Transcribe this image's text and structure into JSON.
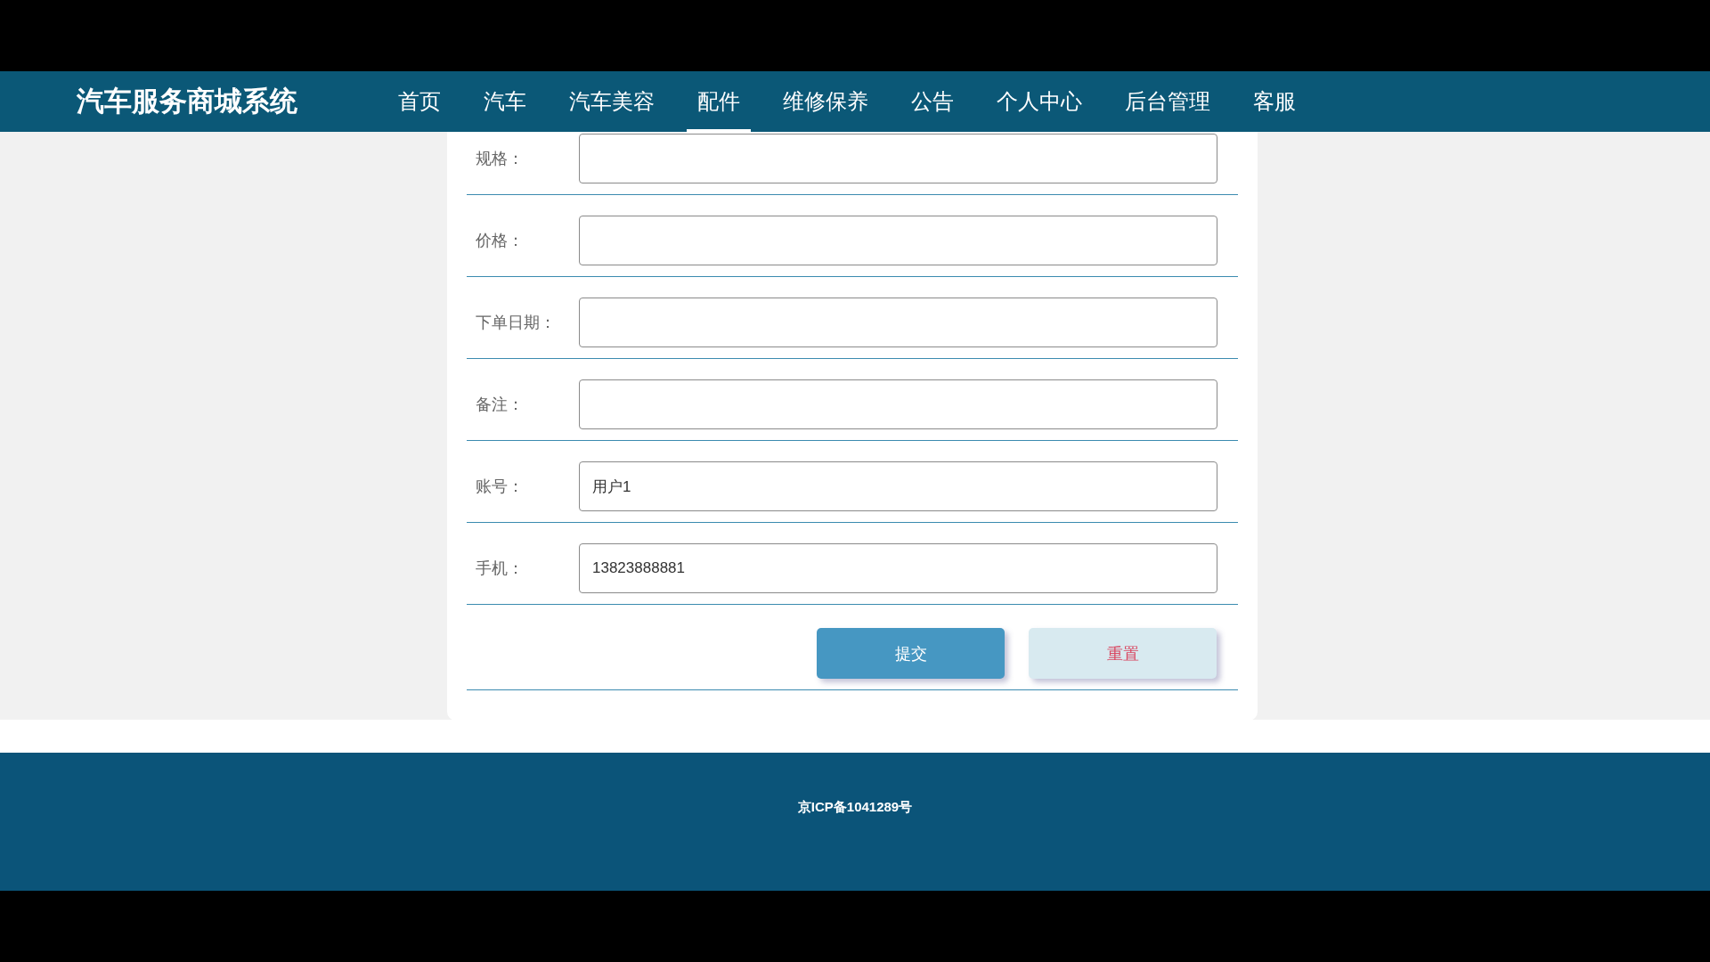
{
  "header": {
    "title": "汽车服务商城系统",
    "nav": [
      {
        "label": "首页",
        "selected": false
      },
      {
        "label": "汽车",
        "selected": false
      },
      {
        "label": "汽车美容",
        "selected": false
      },
      {
        "label": "配件",
        "selected": true
      },
      {
        "label": "维修保养",
        "selected": false
      },
      {
        "label": "公告",
        "selected": false
      },
      {
        "label": "个人中心",
        "selected": false
      },
      {
        "label": "后台管理",
        "selected": false
      },
      {
        "label": "客服",
        "selected": false
      }
    ]
  },
  "form": {
    "fields": [
      {
        "label": "规格："
      },
      {
        "label": "价格："
      },
      {
        "label": "下单日期："
      },
      {
        "label": "备注："
      },
      {
        "label": "账号：",
        "value": "用户1"
      },
      {
        "label": "手机：",
        "value": "13823888881"
      }
    ],
    "buttons": [
      {
        "kind": "submit",
        "label": "提交"
      },
      {
        "kind": "reset",
        "label": "重置"
      }
    ]
  },
  "footer": {
    "text": "京ICP备1041289号"
  }
}
